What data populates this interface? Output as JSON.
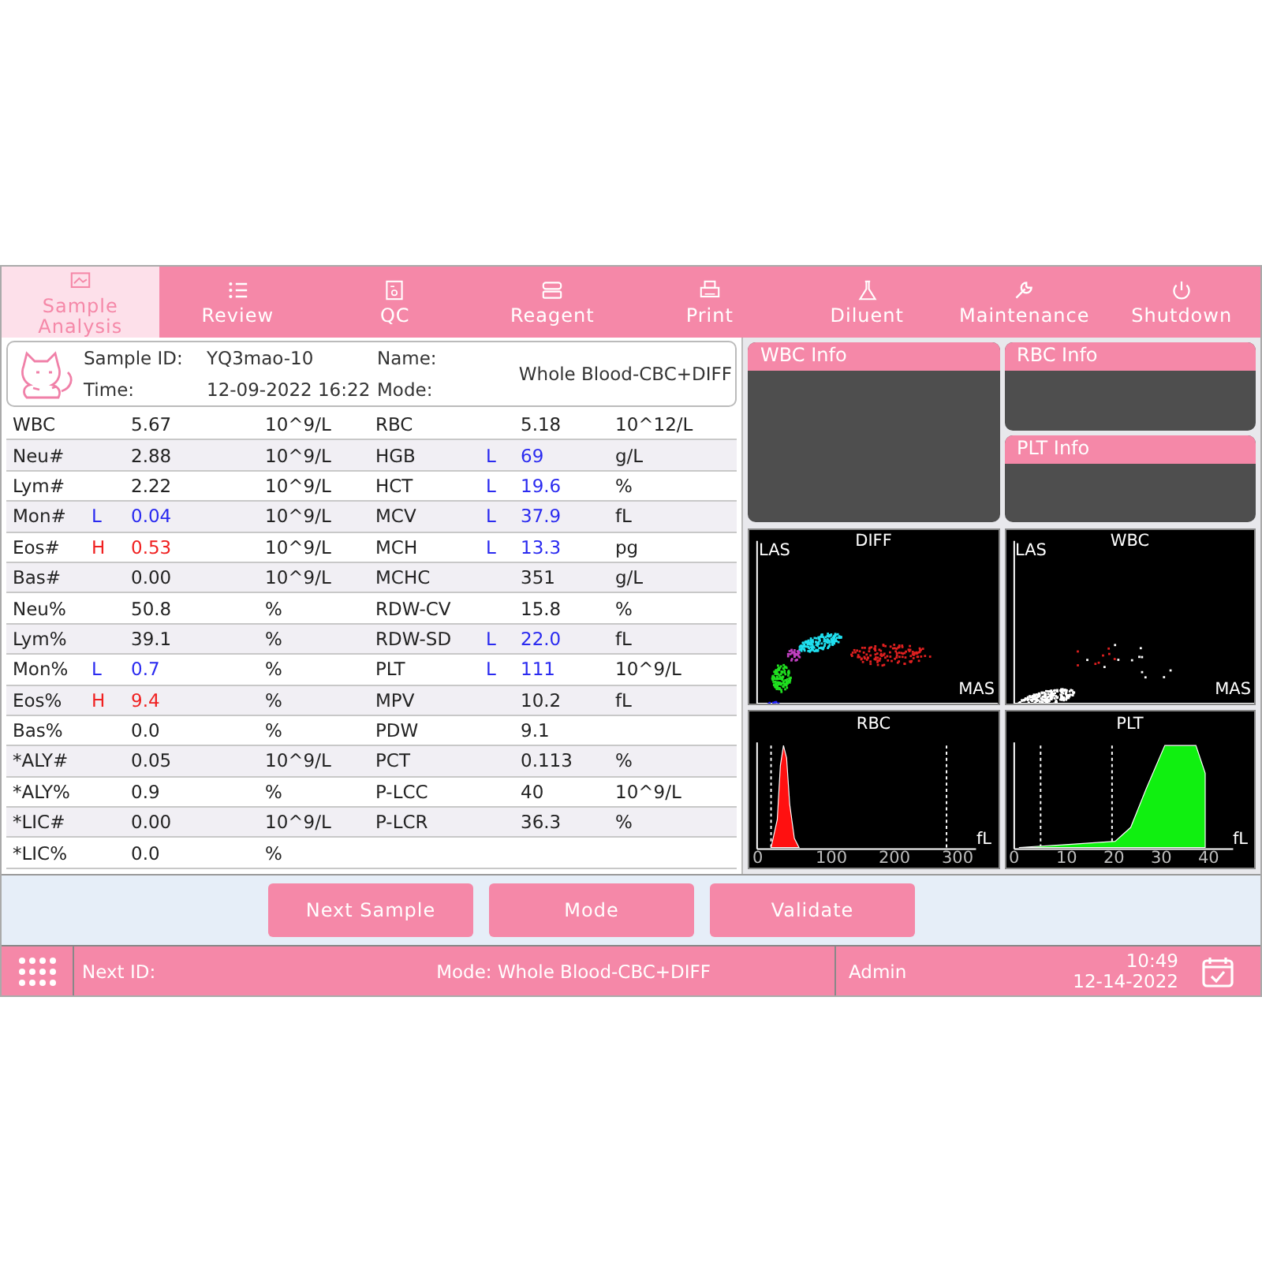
{
  "tabs": [
    {
      "label": "Sample Analysis",
      "selected": true
    },
    {
      "label": "Review",
      "selected": false
    },
    {
      "label": "QC",
      "selected": false
    },
    {
      "label": "Reagent",
      "selected": false
    },
    {
      "label": "Print",
      "selected": false
    },
    {
      "label": "Diluent",
      "selected": false
    },
    {
      "label": "Maintenance",
      "selected": false
    },
    {
      "label": "Shutdown",
      "selected": false
    }
  ],
  "sample": {
    "id_label": "Sample ID:",
    "id": "YQ3mao-10",
    "name_label": "Name:",
    "time_label": "Time:",
    "time": "12-09-2022 16:22",
    "mode_label": "Mode:",
    "mode": "Whole Blood-CBC+DIFF"
  },
  "rows": [
    {
      "left": {
        "name": "WBC",
        "value": "5.67",
        "unit": "10^9/L"
      },
      "right": {
        "name": "RBC",
        "value": "5.18",
        "unit": "10^12/L"
      }
    },
    {
      "left": {
        "name": "Neu#",
        "value": "2.88",
        "unit": "10^9/L"
      },
      "right": {
        "name": "HGB",
        "flag": "L",
        "value": "69",
        "unit": "g/L"
      }
    },
    {
      "left": {
        "name": "Lym#",
        "value": "2.22",
        "unit": "10^9/L"
      },
      "right": {
        "name": "HCT",
        "flag": "L",
        "value": "19.6",
        "unit": "%"
      }
    },
    {
      "left": {
        "name": "Mon#",
        "flag": "L",
        "value": "0.04",
        "unit": "10^9/L"
      },
      "right": {
        "name": "MCV",
        "flag": "L",
        "value": "37.9",
        "unit": "fL"
      }
    },
    {
      "left": {
        "name": "Eos#",
        "flag": "H",
        "value": "0.53",
        "unit": "10^9/L"
      },
      "right": {
        "name": "MCH",
        "flag": "L",
        "value": "13.3",
        "unit": "pg"
      }
    },
    {
      "left": {
        "name": "Bas#",
        "value": "0.00",
        "unit": "10^9/L"
      },
      "right": {
        "name": "MCHC",
        "value": "351",
        "unit": "g/L"
      }
    },
    {
      "left": {
        "name": "Neu%",
        "value": "50.8",
        "unit": "%"
      },
      "right": {
        "name": "RDW-CV",
        "value": "15.8",
        "unit": "%"
      }
    },
    {
      "left": {
        "name": "Lym%",
        "value": "39.1",
        "unit": "%"
      },
      "right": {
        "name": "RDW-SD",
        "flag": "L",
        "value": "22.0",
        "unit": "fL"
      }
    },
    {
      "left": {
        "name": "Mon%",
        "flag": "L",
        "value": "0.7",
        "unit": "%"
      },
      "right": {
        "name": "PLT",
        "flag": "L",
        "value": "111",
        "unit": "10^9/L"
      }
    },
    {
      "left": {
        "name": "Eos%",
        "flag": "H",
        "value": "9.4",
        "unit": "%"
      },
      "right": {
        "name": "MPV",
        "value": "10.2",
        "unit": "fL"
      }
    },
    {
      "left": {
        "name": "Bas%",
        "value": "0.0",
        "unit": "%"
      },
      "right": {
        "name": "PDW",
        "value": "9.1"
      }
    },
    {
      "left": {
        "name": "*ALY#",
        "value": "0.05",
        "unit": "10^9/L"
      },
      "right": {
        "name": "PCT",
        "value": "0.113",
        "unit": "%"
      }
    },
    {
      "left": {
        "name": "*ALY%",
        "value": "0.9",
        "unit": "%"
      },
      "right": {
        "name": "P-LCC",
        "value": "40",
        "unit": "10^9/L"
      }
    },
    {
      "left": {
        "name": "*LIC#",
        "value": "0.00",
        "unit": "10^9/L"
      },
      "right": {
        "name": "P-LCR",
        "value": "36.3",
        "unit": "%"
      }
    },
    {
      "left": {
        "name": "*LIC%",
        "value": "0.0",
        "unit": "%"
      }
    }
  ],
  "info_panels": [
    {
      "title": "WBC Info"
    },
    {
      "title": "RBC Info"
    },
    {
      "title": "PLT Info"
    }
  ],
  "scatters": [
    {
      "kind": "diff",
      "title": "DIFF",
      "y_label": "LAS",
      "x_label": "MAS"
    },
    {
      "kind": "wbc",
      "title": "WBC",
      "y_label": "LAS",
      "x_label": "MAS"
    }
  ],
  "histograms": [
    {
      "kind": "rbc",
      "title": "RBC",
      "unit": "fL",
      "ticks": [
        "0",
        "100",
        "200",
        "300"
      ]
    },
    {
      "kind": "plt",
      "title": "PLT",
      "unit": "fL",
      "ticks": [
        "0",
        "10",
        "20",
        "30",
        "40"
      ]
    }
  ],
  "buttons": [
    "Next Sample",
    "Mode",
    "Validate"
  ],
  "status": {
    "next_id_label": "Next ID:",
    "mode": "Mode: Whole Blood-CBC+DIFF",
    "user": "Admin",
    "time": "10:49",
    "date": "12-14-2022"
  }
}
